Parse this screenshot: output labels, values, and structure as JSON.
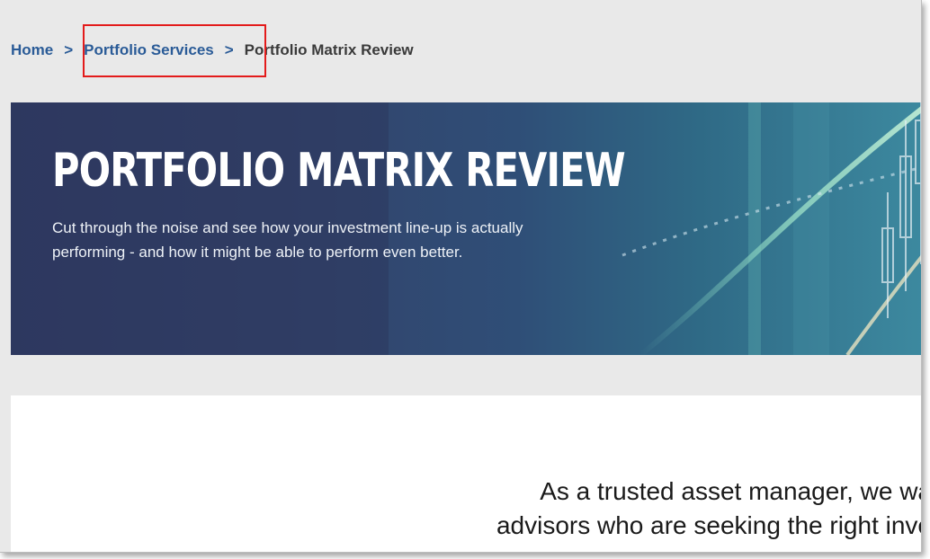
{
  "breadcrumb": {
    "home": "Home",
    "separator": ">",
    "services": "Portfolio Services",
    "current": "Portfolio Matrix Review"
  },
  "hero": {
    "title": "PORTFOLIO MATRIX REVIEW",
    "subtitle_line1": "Cut through the noise and see how your investment line-up is actually",
    "subtitle_line2": "performing - and how it might be able to perform even better."
  },
  "content": {
    "intro_line1": "As a trusted asset manager, we wa",
    "intro_line2": "advisors who are seeking the right inve"
  },
  "colors": {
    "link": "#2a5b97",
    "highlight": "#e31b1b",
    "hero_bg": "#2f3a63",
    "page_bg": "#e9e9e9"
  }
}
